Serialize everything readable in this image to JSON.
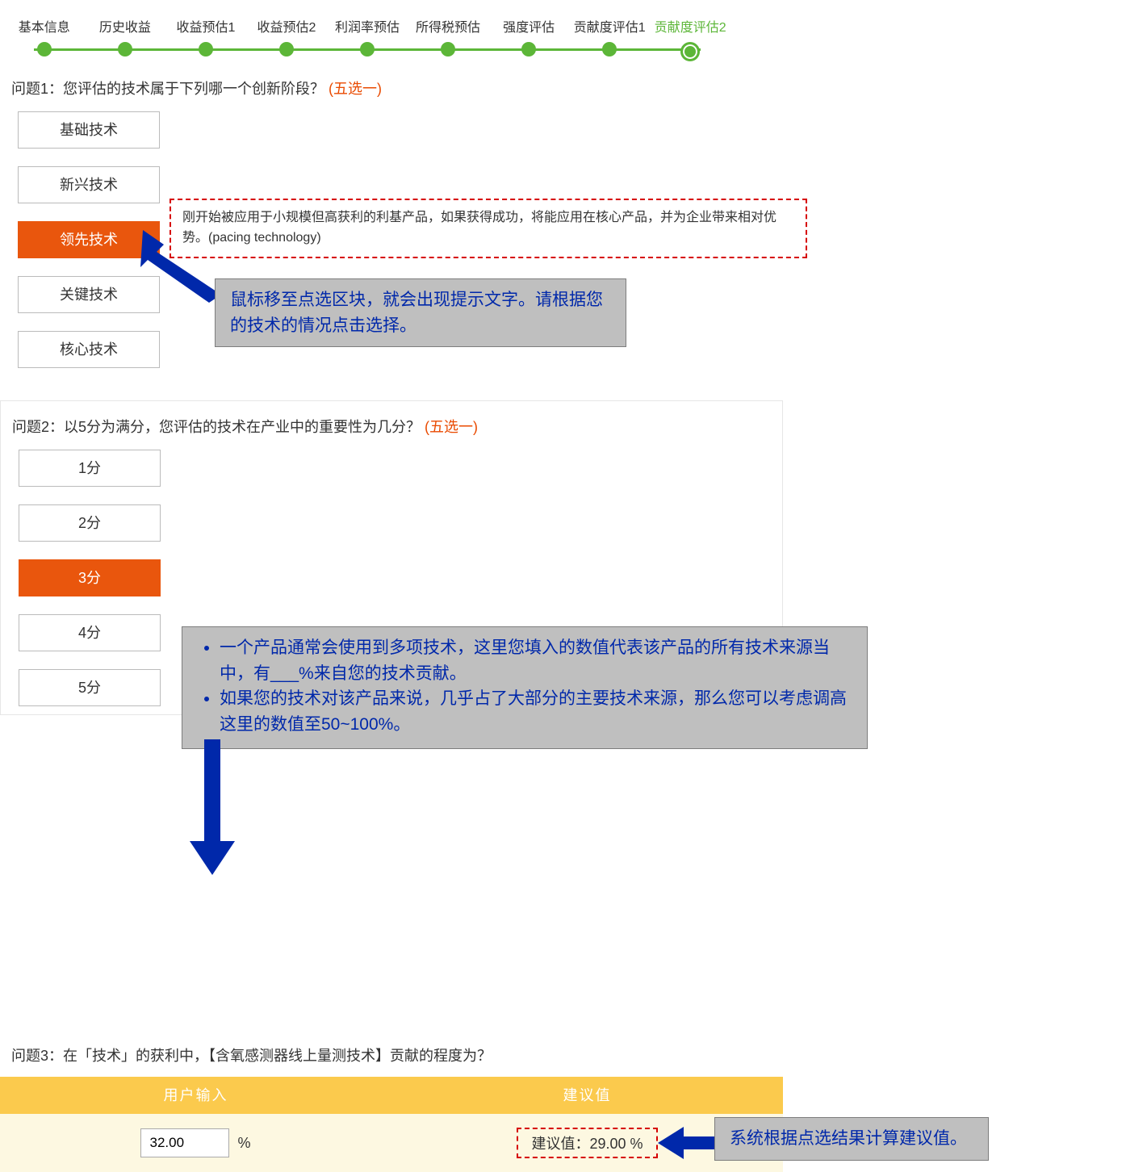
{
  "stepper": {
    "steps": [
      {
        "label": "基本信息"
      },
      {
        "label": "历史收益"
      },
      {
        "label": "收益预估1"
      },
      {
        "label": "收益预估2"
      },
      {
        "label": "利润率预估"
      },
      {
        "label": "所得税预估"
      },
      {
        "label": "强度评估"
      },
      {
        "label": "贡献度评估1"
      },
      {
        "label": "贡献度评估2"
      }
    ],
    "active_index": 8
  },
  "q1": {
    "prefix": "问题1：您评估的技术属于下列哪一个创新阶段？",
    "paren": "(五选一)",
    "options": [
      "基础技术",
      "新兴技术",
      "领先技术",
      "关键技术",
      "核心技术"
    ],
    "selected_index": 2,
    "tooltip": "刚开始被应用于小规模但高获利的利基产品，如果获得成功，将能应用在核心产品，并为企业带来相对优势。(pacing technology)"
  },
  "annot1": {
    "text": "鼠标移至点选区块，就会出现提示文字。请根据您的技术的情况点击选择。"
  },
  "q2": {
    "prefix": "问题2：以5分为满分，您评估的技术在产业中的重要性为几分？",
    "paren": "(五选一)",
    "options": [
      "1分",
      "2分",
      "3分",
      "4分",
      "5分"
    ],
    "selected_index": 2
  },
  "annot2": {
    "b1": "一个产品通常会使用到多项技术，这里您填入的数值代表该产品的所有技术来源当中，有___%来自您的技术贡献。",
    "b2": "如果您的技术对该产品来说，几乎占了大部分的主要技术来源，那么您可以考虑调高这里的数值至50~100%。"
  },
  "q3": {
    "title": "问题3：在「技术」的获利中，【含氧感测器线上量测技术】贡献的程度为？",
    "head_left": "用户输入",
    "head_right": "建议值",
    "user_value": "32.00",
    "user_unit": "%",
    "suggest_text": "建议值：29.00 %"
  },
  "annot3": {
    "text": "系统根据点选结果计算建议值。"
  }
}
